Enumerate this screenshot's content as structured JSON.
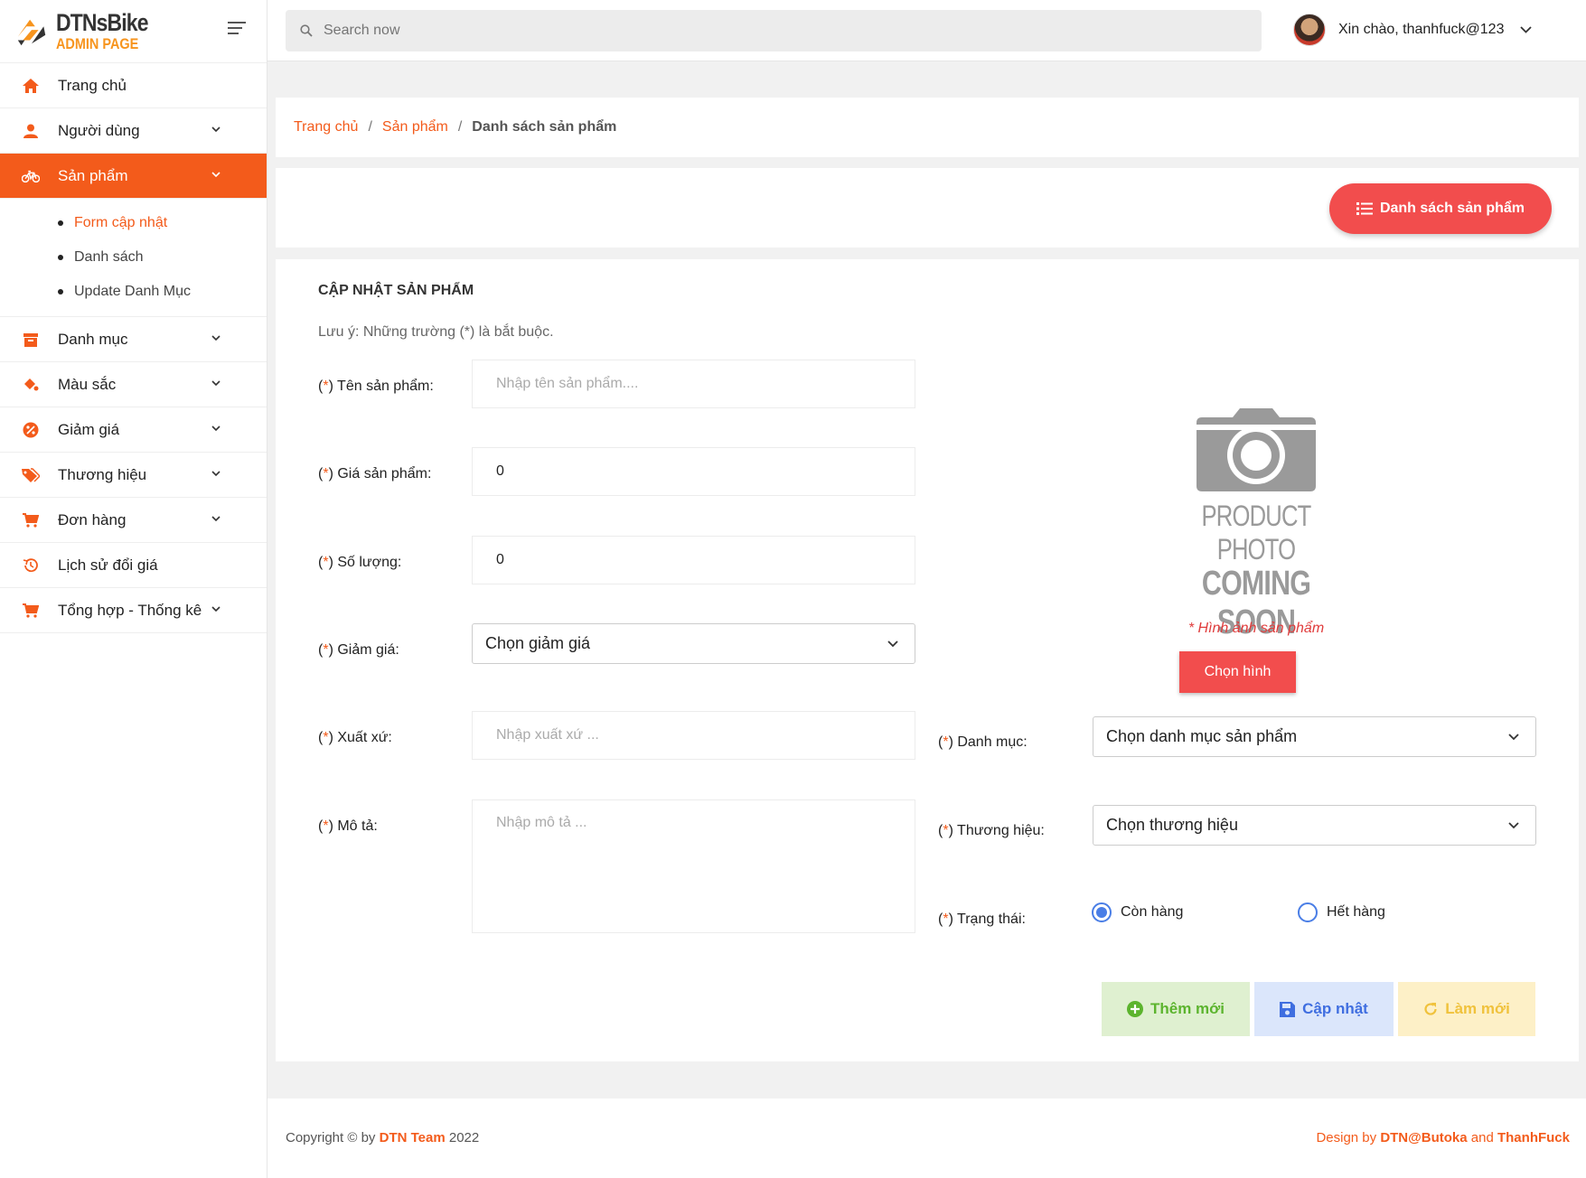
{
  "brand": {
    "title": "DTNsBike",
    "subtitle": "ADMIN PAGE"
  },
  "search": {
    "placeholder": "Search now"
  },
  "user": {
    "greeting": "Xin chào, thanhfuck@123"
  },
  "sidebar": {
    "items": [
      {
        "label": "Trang chủ",
        "icon": "home-icon"
      },
      {
        "label": "Người dùng",
        "icon": "user-icon"
      },
      {
        "label": "Sản phẩm",
        "icon": "bicycle-icon",
        "active": true
      },
      {
        "label": "Danh mục",
        "icon": "archive-icon"
      },
      {
        "label": "Màu sắc",
        "icon": "paint-bucket-icon"
      },
      {
        "label": "Giảm giá",
        "icon": "discount-badge-icon"
      },
      {
        "label": "Thương hiệu",
        "icon": "tags-icon"
      },
      {
        "label": "Đơn hàng",
        "icon": "cart-icon"
      },
      {
        "label": "Lịch sử đổi giá",
        "icon": "history-icon"
      },
      {
        "label": "Tổng hợp - Thống kê",
        "icon": "cart-icon"
      }
    ],
    "submenu": [
      "Form cập nhật",
      "Danh sách",
      "Update Danh Mục"
    ]
  },
  "breadcrumb": {
    "home": "Trang chủ",
    "section": "Sản phẩm",
    "current": "Danh sách sản phẩm"
  },
  "actions": {
    "list_button": "Danh sách sản phẩm"
  },
  "form": {
    "title": "CẬP NHẬT SẢN PHẨM",
    "note": "Lưu ý: Những trường (*) là bắt buộc.",
    "required_mark": "*",
    "name_label": "Tên sản phẩm:",
    "name_placeholder": "Nhập tên sản phẩm....",
    "price_label": "Giá sản phẩm:",
    "price_value": "0",
    "qty_label": "Số lượng:",
    "qty_value": "0",
    "discount_label": "Giảm giá:",
    "discount_selected": "Chọn giảm giá",
    "origin_label": "Xuất xứ:",
    "origin_placeholder": "Nhập xuất xứ ...",
    "desc_label": "Mô tả:",
    "desc_placeholder": "Nhập mô tả ...",
    "category_label": "Danh mục:",
    "category_selected": "Chọn danh mục sản phẩm",
    "brand_label": "Thương hiệu:",
    "brand_selected": "Chọn thương hiệu",
    "status_label": "Trạng thái:",
    "status_in_stock": "Còn hàng",
    "status_out_stock": "Hết hàng",
    "status_selected": "Còn hàng",
    "photo_line1": "PRODUCT PHOTO",
    "photo_line2": "COMING SOON",
    "image_caption": "* Hình ảnh sản phẩm",
    "pick_image": "Chọn hình",
    "add_button": "Thêm mới",
    "update_button": "Cập nhật",
    "reset_button": "Làm mới"
  },
  "footer": {
    "copyright_prefix": "Copyright © by",
    "team": "DTN Team",
    "year": "2022",
    "design_prefix": "Design by",
    "designer1": "DTN@Butoka",
    "and": "and",
    "designer2": "ThanhFuck"
  },
  "colors": {
    "accent": "#f35b1b",
    "danger": "#f24d4d"
  }
}
